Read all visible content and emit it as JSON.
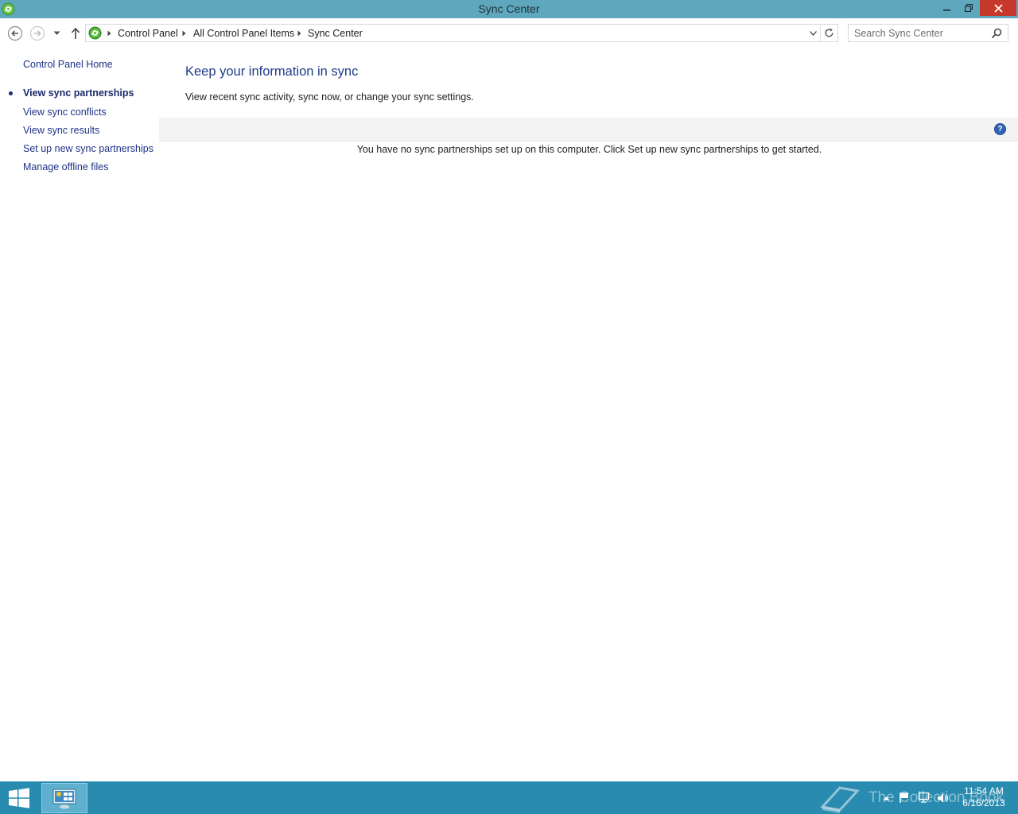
{
  "window": {
    "title": "Sync Center",
    "buttons": {
      "minimize": "minimize",
      "restore": "restore",
      "close": "close"
    }
  },
  "address": {
    "crumbs": [
      "Control Panel",
      "All Control Panel Items",
      "Sync Center"
    ]
  },
  "search": {
    "placeholder": "Search Sync Center"
  },
  "sidebar": {
    "home": "Control Panel Home",
    "items": [
      {
        "label": "View sync partnerships",
        "active": true
      },
      {
        "label": "View sync conflicts",
        "active": false
      },
      {
        "label": "View sync results",
        "active": false
      },
      {
        "label": "Set up new sync partnerships",
        "active": false
      },
      {
        "label": "Manage offline files",
        "active": false
      }
    ]
  },
  "main": {
    "heading": "Keep your information in sync",
    "description": "View recent sync activity, sync now, or change your sync settings.",
    "help_glyph": "?",
    "empty_message": "You have no sync partnerships set up on this computer. Click Set up new sync partnerships to get started."
  },
  "taskbar": {
    "watermark": "The Collection Book",
    "time": "11:54 AM",
    "date": "6/16/2013"
  },
  "colors": {
    "titlebar": "#5fa7bd",
    "close_button": "#c7382c",
    "taskbar": "#2a8bb0",
    "link": "#1e3287",
    "heading": "#1e3a8a"
  },
  "icons": {
    "app": "sync-center-icon",
    "back": "back-arrow-icon",
    "forward": "forward-arrow-icon",
    "recent": "chevron-down-icon",
    "up": "up-arrow-icon",
    "refresh": "refresh-icon",
    "search": "search-icon",
    "help": "help-icon",
    "start": "windows-logo-icon"
  }
}
